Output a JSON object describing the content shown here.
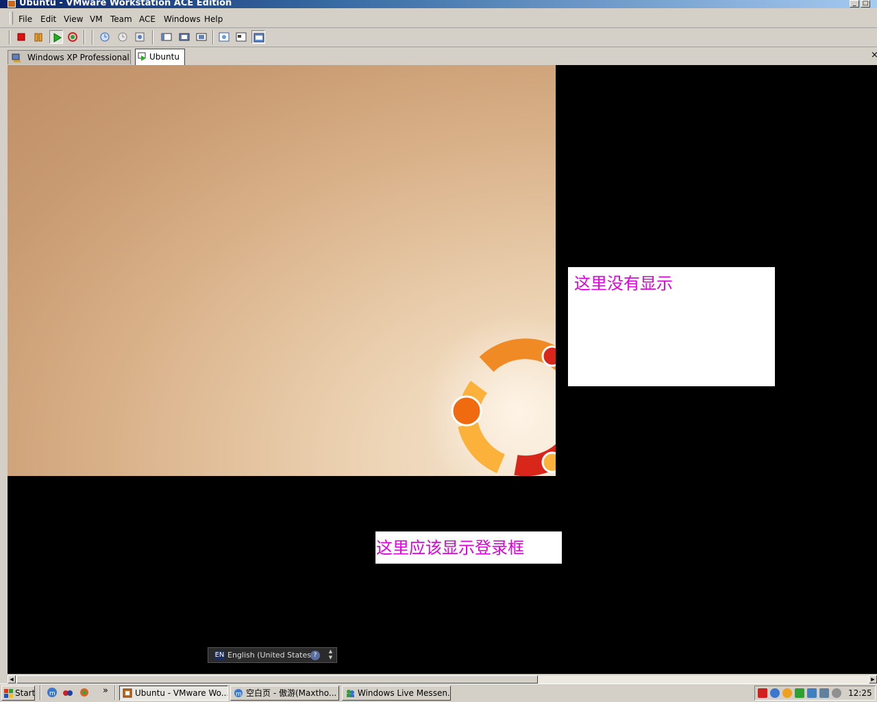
{
  "window": {
    "title": "Ubuntu - VMware Workstation ACE Edition"
  },
  "menu": [
    "File",
    "Edit",
    "View",
    "VM",
    "Team",
    "ACE",
    "Windows",
    "Help"
  ],
  "toolbar_icons": [
    "power-off-icon",
    "suspend-icon",
    "power-on-icon",
    "reset-icon",
    "snapshot-icon",
    "revert-snapshot-icon",
    "snapshot-manager-icon",
    "quick-switch-icon",
    "full-screen-icon",
    "fit-guest-icon",
    "summary-icon",
    "console-icon",
    "appliance-view-icon"
  ],
  "tabs": [
    {
      "label": "Windows XP Professional",
      "active": false
    },
    {
      "label": "Ubuntu",
      "active": true
    }
  ],
  "vm": {
    "annotation_right": "这里没有显示",
    "annotation_bottom": "这里应该显示登录框",
    "language": {
      "code": "EN",
      "label": "English (United States)",
      "help": "?"
    }
  },
  "taskbar": {
    "start_label": "Start",
    "more": "»",
    "buttons": [
      {
        "label": "Ubuntu - VMware Wo...",
        "active": true
      },
      {
        "label": "空白页 - 傲游(Maxtho...",
        "active": false
      },
      {
        "label": "Windows Live Messen...",
        "active": false
      }
    ],
    "clock": "12:25"
  },
  "colors": {
    "annotation_text": "#e000e0",
    "title_bar_start": "#0a246a",
    "title_bar_end": "#a6caf0",
    "ubuntu_orange": "#f08a24",
    "ubuntu_red": "#d8261a",
    "ubuntu_yellow": "#fbb13a"
  }
}
